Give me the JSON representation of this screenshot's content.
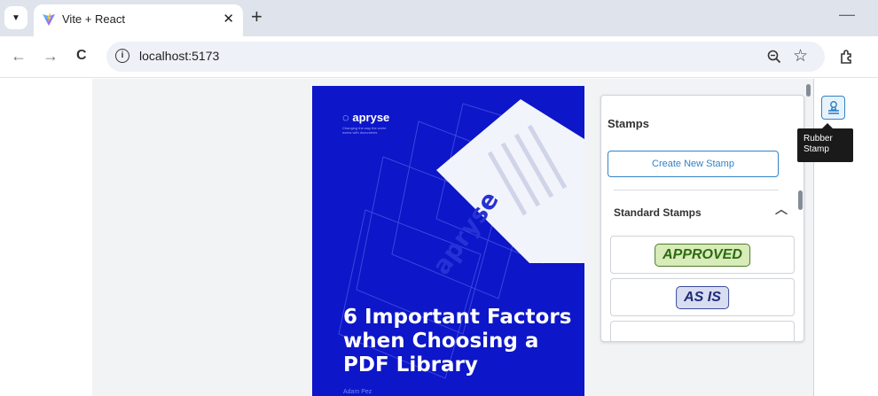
{
  "browser": {
    "tab_title": "Vite + React",
    "tab_close": "✕",
    "new_tab": "+",
    "minimize": "—",
    "url": "localhost:5173",
    "nav": {
      "back": "←",
      "forward": "→",
      "reload": "C"
    },
    "icons": {
      "zoom": "🔍",
      "star": "☆",
      "extensions": "⧉",
      "info": "i"
    }
  },
  "document": {
    "brand": "apryse",
    "tagline": "Changing the way the world works with documents",
    "headline_lines": [
      "6 Important Factors",
      "when Choosing a",
      "PDF Library"
    ],
    "author": "Adam Pez"
  },
  "stamps_panel": {
    "title": "Stamps",
    "create_button": "Create New Stamp",
    "section_title": "Standard Stamps",
    "stamps": [
      {
        "label": "APPROVED",
        "color": "#2d6a12"
      },
      {
        "label": "AS IS",
        "color": "#1f2c7a"
      }
    ]
  },
  "toolbar_button": {
    "tooltip_line1": "Rubber",
    "tooltip_line2": "Stamp",
    "accent": "#3183c8"
  }
}
